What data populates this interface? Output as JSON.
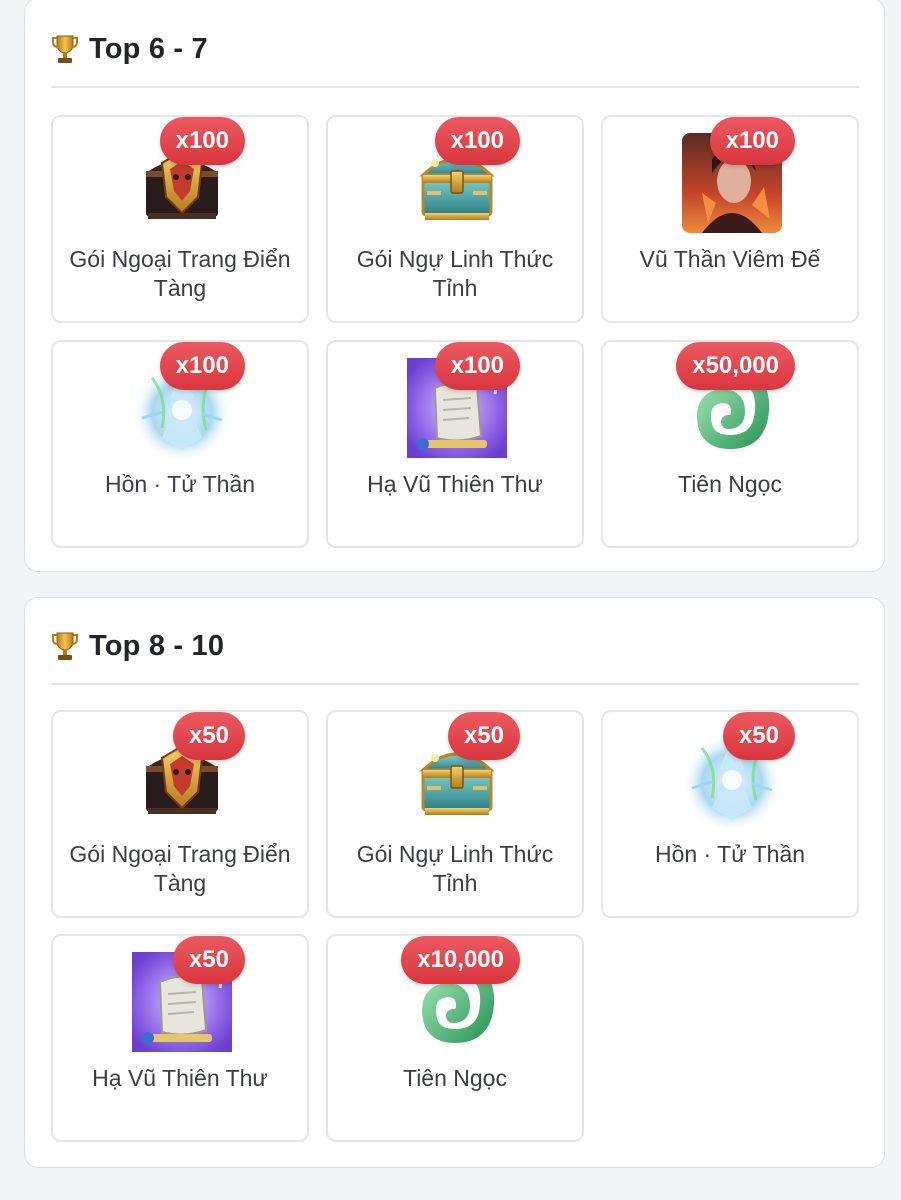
{
  "sections": [
    {
      "title": "Top 6 - 7",
      "items": [
        {
          "name": "Gói Ngoại Trang Điển Tàng",
          "qty": "x100",
          "icon": "dark-chest-icon"
        },
        {
          "name": "Gói Ngự Linh Thức Tỉnh",
          "qty": "x100",
          "icon": "gold-chest-icon"
        },
        {
          "name": "Vũ Thần Viêm Đế",
          "qty": "x100",
          "icon": "warrior-portrait-icon"
        },
        {
          "name": "Hồn · Tử Thần",
          "qty": "x100",
          "icon": "spirit-crystal-icon"
        },
        {
          "name": "Hạ Vũ Thiên Thư",
          "qty": "x100",
          "icon": "scroll-icon"
        },
        {
          "name": "Tiên Ngọc",
          "qty": "x50,000",
          "icon": "jade-dragon-icon"
        }
      ]
    },
    {
      "title": "Top 8 - 10",
      "items": [
        {
          "name": "Gói Ngoại Trang Điển Tàng",
          "qty": "x50",
          "icon": "dark-chest-icon"
        },
        {
          "name": "Gói Ngự Linh Thức Tỉnh",
          "qty": "x50",
          "icon": "gold-chest-icon"
        },
        {
          "name": "Hồn · Tử Thần",
          "qty": "x50",
          "icon": "spirit-crystal-icon"
        },
        {
          "name": "Hạ Vũ Thiên Thư",
          "qty": "x50",
          "icon": "scroll-icon"
        },
        {
          "name": "Tiên Ngọc",
          "qty": "x10,000",
          "icon": "jade-dragon-icon"
        }
      ]
    }
  ],
  "colors": {
    "badge": "#e0454d",
    "trophy": "#d4a12a",
    "card_border": "#e4e6e9"
  }
}
